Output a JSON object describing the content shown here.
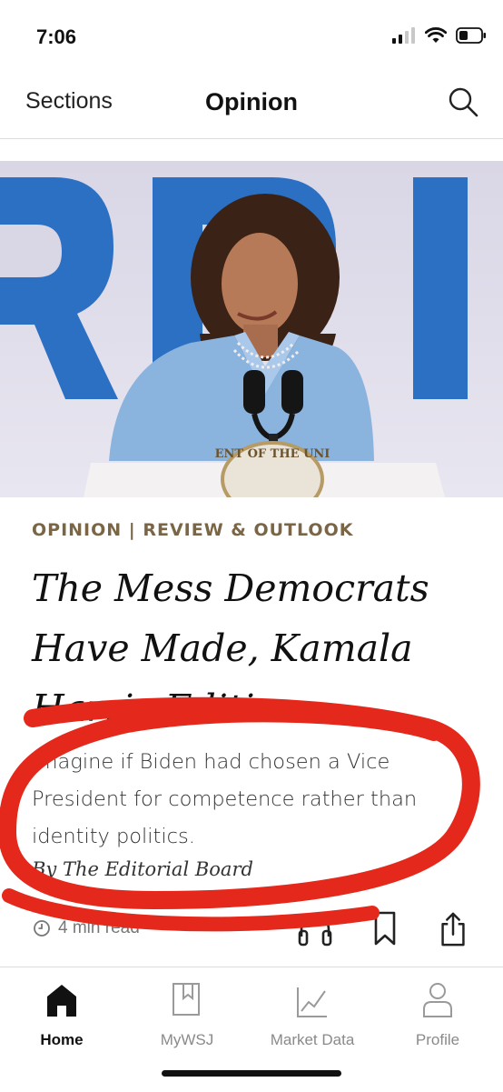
{
  "status_bar": {
    "time": "7:06",
    "icons": [
      "cellular-signal-icon",
      "wifi-icon",
      "battery-icon"
    ]
  },
  "nav": {
    "sections_label": "Sections",
    "title": "Opinion",
    "search_icon": "search-icon"
  },
  "hero": {
    "podium_seal_text": "ENT OF THE UNI"
  },
  "article": {
    "kicker": "OPINION | REVIEW & OUTLOOK",
    "headline": "The Mess Democrats Have Made, Kamala Harris Edition",
    "dek": "Imagine if Biden had chosen a Vice President for competence rather than identity politics.",
    "byline": "By The Editorial Board",
    "read_time": "4 min read",
    "actions": [
      "headphones-icon",
      "bookmark-icon",
      "share-icon"
    ]
  },
  "tabbar": {
    "tabs": [
      {
        "label": "Home",
        "icon": "home-icon",
        "active": true
      },
      {
        "label": "MyWSJ",
        "icon": "mywsj-icon",
        "active": false
      },
      {
        "label": "Market Data",
        "icon": "chart-icon",
        "active": false
      },
      {
        "label": "Profile",
        "icon": "profile-icon",
        "active": false
      }
    ]
  },
  "colors": {
    "kicker": "#7a6646",
    "annotation": "#e4281b",
    "backdrop_blue": "#2b70c2",
    "jacket_blue": "#8ab3de"
  }
}
